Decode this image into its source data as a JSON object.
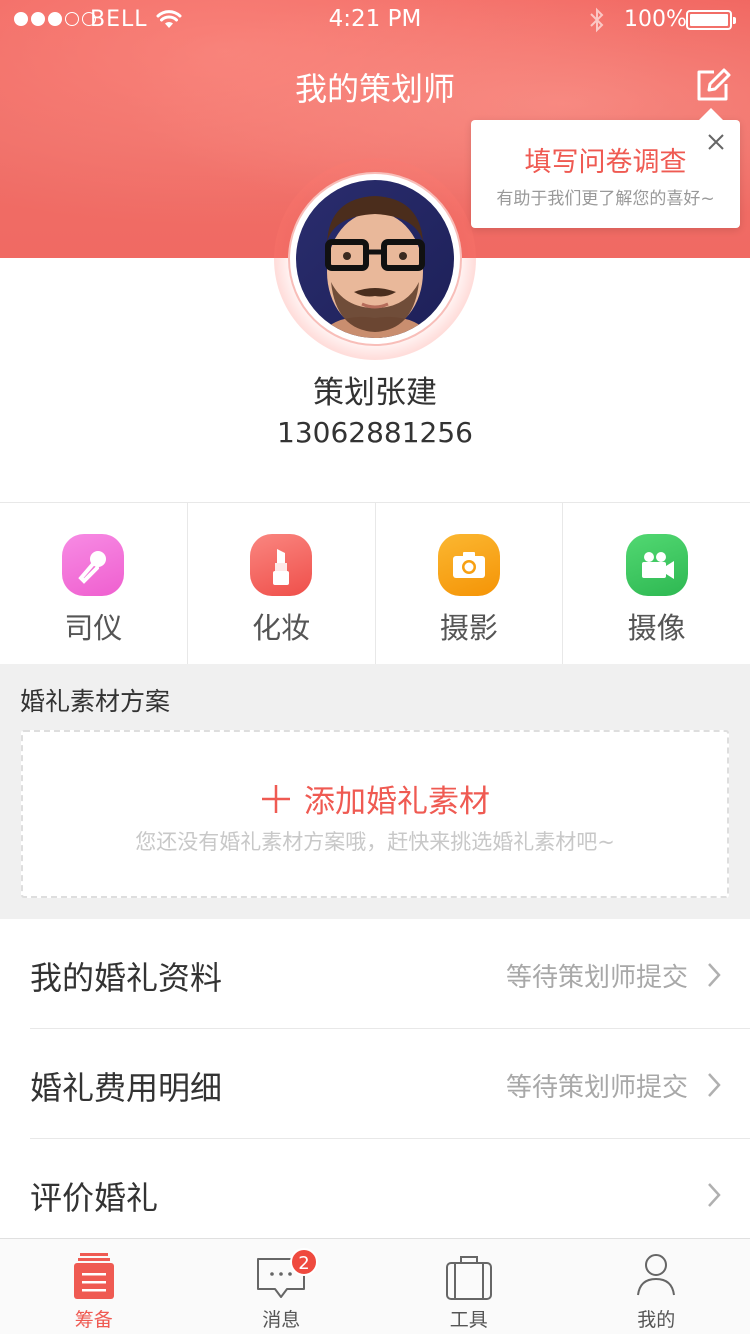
{
  "status_bar": {
    "carrier": "BELL",
    "time": "4:21 PM",
    "battery": "100%"
  },
  "header": {
    "title": "我的策划师"
  },
  "tooltip": {
    "title": "填写问卷调查",
    "subtitle": "有助于我们更了解您的喜好~"
  },
  "planner": {
    "name": "策划张建",
    "phone": "13062881256"
  },
  "services": [
    {
      "label": "司仪",
      "icon": "microphone-icon",
      "color": "#f36fd8"
    },
    {
      "label": "化妆",
      "icon": "lipstick-icon",
      "color": "#f4635f"
    },
    {
      "label": "摄影",
      "icon": "camera-icon",
      "color": "#f7a012"
    },
    {
      "label": "摄像",
      "icon": "video-camera-icon",
      "color": "#35c55e"
    }
  ],
  "material": {
    "section_title": "婚礼素材方案",
    "add_label": "添加婚礼素材",
    "hint": "您还没有婚礼素材方案哦，赶快来挑选婚礼素材吧~"
  },
  "list": [
    {
      "title": "我的婚礼资料",
      "status": "等待策划师提交"
    },
    {
      "title": "婚礼费用明细",
      "status": "等待策划师提交"
    },
    {
      "title": "评价婚礼",
      "status": ""
    }
  ],
  "tabs": [
    {
      "label": "筹备",
      "icon": "calendar-list-icon"
    },
    {
      "label": "消息",
      "icon": "message-bubble-icon",
      "badge": "2"
    },
    {
      "label": "工具",
      "icon": "bag-icon"
    },
    {
      "label": "我的",
      "icon": "person-icon"
    }
  ],
  "colors": {
    "accent": "#ef5a52",
    "header": "#f0675f"
  }
}
